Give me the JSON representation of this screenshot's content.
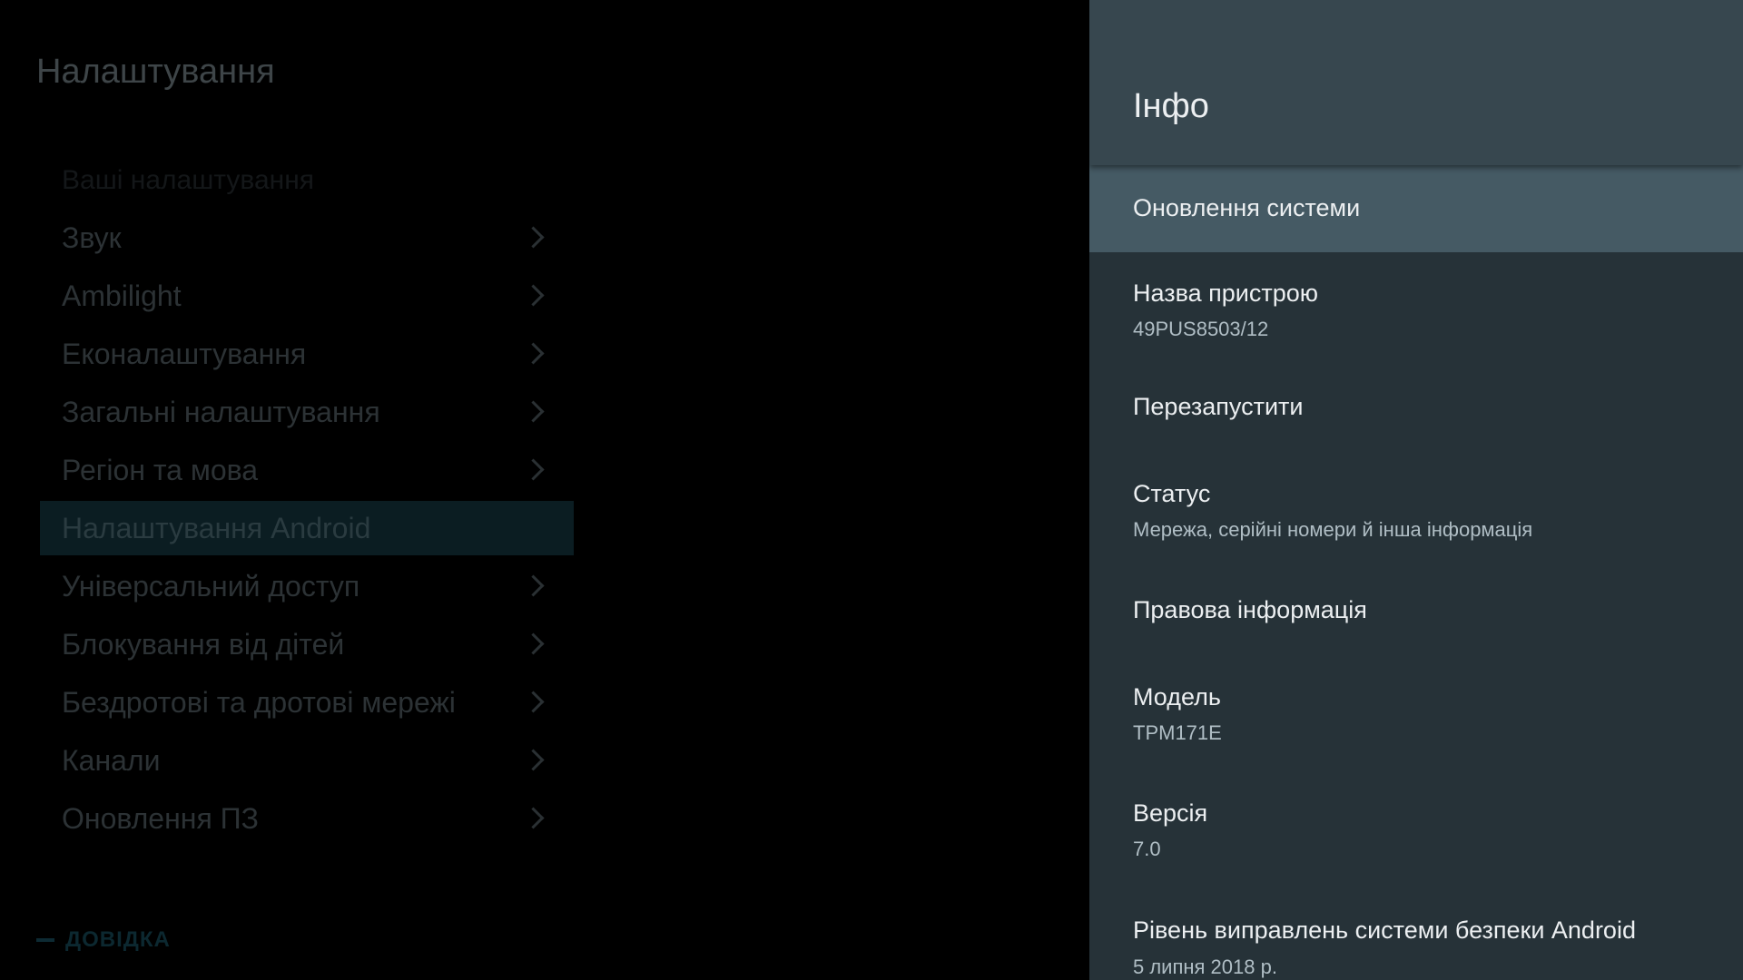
{
  "settings": {
    "title": "Налаштування",
    "section_label": "Ваші налаштування",
    "items": [
      {
        "label": "Звук",
        "has_arrow": true
      },
      {
        "label": "Ambilight",
        "has_arrow": true
      },
      {
        "label": "Еконалаштування",
        "has_arrow": true
      },
      {
        "label": "Загальні налаштування",
        "has_arrow": true
      },
      {
        "label": "Регіон та мова",
        "has_arrow": true
      },
      {
        "label": "Налаштування Android",
        "has_arrow": false,
        "selected": true
      },
      {
        "label": "Універсальний доступ",
        "has_arrow": true
      },
      {
        "label": "Блокування від дітей",
        "has_arrow": true
      },
      {
        "label": "Бездротові та дротові мережі",
        "has_arrow": true
      },
      {
        "label": "Канали",
        "has_arrow": true
      },
      {
        "label": "Оновлення ПЗ",
        "has_arrow": true
      }
    ],
    "help_label": "ДОВІДКА"
  },
  "info_panel": {
    "title": "Інфо",
    "items": [
      {
        "title": "Оновлення системи",
        "focused": true
      },
      {
        "title": "Назва пристрою",
        "subtitle": "49PUS8503/12"
      },
      {
        "title": "Перезапустити"
      },
      {
        "title": "Статус",
        "subtitle": "Мережа, серійні номери й інша інформація"
      },
      {
        "title": "Правова інформація"
      },
      {
        "title": "Модель",
        "subtitle": "TPM171E"
      },
      {
        "title": "Версія",
        "subtitle": "7.0"
      },
      {
        "title": "Рівень виправлень системи безпеки Android",
        "subtitle": "5 липня 2018 р."
      }
    ]
  },
  "colors": {
    "panel_header": "#37474f",
    "panel_body": "#263238",
    "focused_row": "#455a64",
    "left_selected_row": "#0b1d22"
  }
}
